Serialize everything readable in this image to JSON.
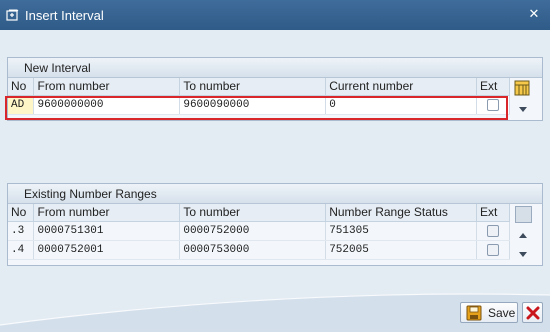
{
  "window": {
    "title": "Insert Interval"
  },
  "new_interval": {
    "title": "New Interval",
    "columns": [
      "No",
      "From number",
      "To number",
      "Current number",
      "Ext"
    ],
    "row": {
      "no": "AD",
      "from": "9600000000",
      "to": "9600090000",
      "current": "0",
      "ext": false
    }
  },
  "existing": {
    "title": "Existing Number Ranges",
    "columns": [
      "No",
      "From number",
      "To number",
      "Number Range Status",
      "Ext"
    ],
    "rows": [
      {
        "no": ".3",
        "from": "0000751301",
        "to": "0000752000",
        "status": "751305",
        "ext": false
      },
      {
        "no": ".4",
        "from": "0000752001",
        "to": "0000753000",
        "status": "752005",
        "ext": false
      }
    ]
  },
  "buttons": {
    "save_label": "Save"
  },
  "icons": {
    "title": "insert-window-icon",
    "close": "close-icon",
    "column_config": "column-config-icon",
    "scroll_down": "scroll-down-icon",
    "scroll_up": "scroll-up-icon",
    "save": "save-icon",
    "cancel": "cancel-icon"
  },
  "colors": {
    "highlight": "#d9262b",
    "titlebar": "#2f5b89",
    "key_cell": "#fff6c8"
  }
}
